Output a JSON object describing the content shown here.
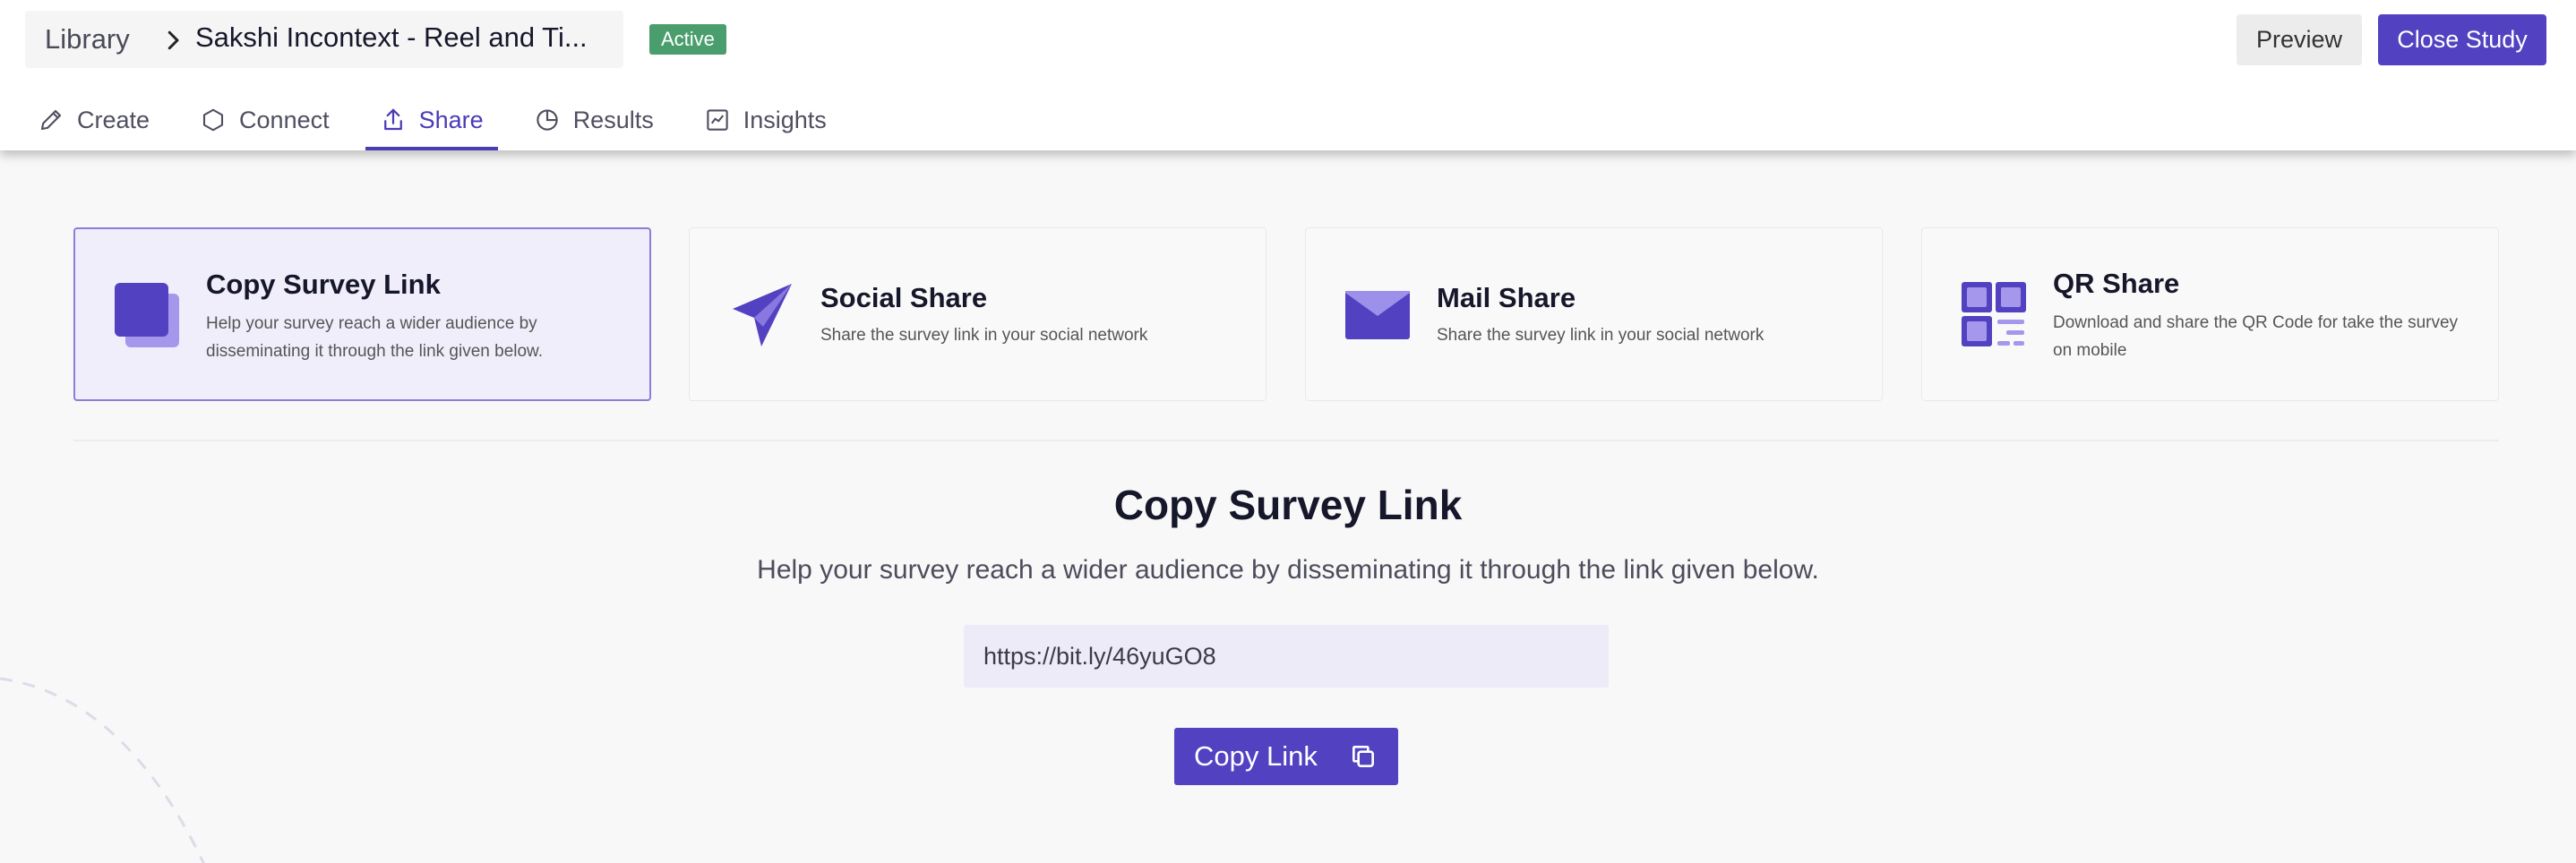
{
  "header": {
    "breadcrumb_root": "Library",
    "study_title": "Sakshi Incontext - Reel and Ti...",
    "status_badge": "Active",
    "preview_label": "Preview",
    "close_label": "Close Study"
  },
  "tabs": [
    {
      "label": "Create",
      "icon": "pencil-icon",
      "active": false
    },
    {
      "label": "Connect",
      "icon": "hexagon-icon",
      "active": false
    },
    {
      "label": "Share",
      "icon": "share-upload-icon",
      "active": true
    },
    {
      "label": "Results",
      "icon": "pie-chart-icon",
      "active": false
    },
    {
      "label": "Insights",
      "icon": "line-chart-icon",
      "active": false
    }
  ],
  "share_options": [
    {
      "title": "Copy Survey Link",
      "description": "Help your survey reach a wider audience by disseminating it through the link given below.",
      "icon": "copy-squares-icon",
      "selected": true
    },
    {
      "title": "Social Share",
      "description": "Share the survey link in your social network",
      "icon": "paper-plane-icon",
      "selected": false
    },
    {
      "title": "Mail Share",
      "description": "Share the survey link in your social network",
      "icon": "envelope-icon",
      "selected": false
    },
    {
      "title": "QR Share",
      "description": "Download and share the QR Code for take the survey on mobile",
      "icon": "qr-code-icon",
      "selected": false
    }
  ],
  "main": {
    "title": "Copy Survey Link",
    "subtitle": "Help your survey reach a wider audience by disseminating it through the link given below.",
    "link_value": "https://bit.ly/46yuGO8",
    "copy_button_label": "Copy Link"
  },
  "colors": {
    "accent": "#5241c0",
    "badge_green": "#4a9e6d",
    "selected_card_bg": "#f0eefb",
    "link_field_bg": "#edebf7"
  }
}
